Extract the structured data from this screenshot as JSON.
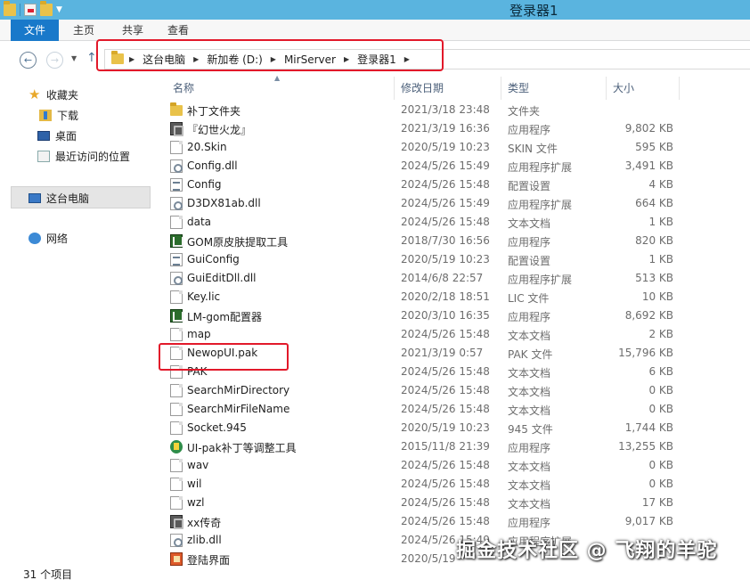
{
  "window": {
    "title": "登录器1"
  },
  "ribbon": {
    "tabs": [
      {
        "label": "文件"
      },
      {
        "label": "主页"
      },
      {
        "label": "共享"
      },
      {
        "label": "查看"
      }
    ]
  },
  "address": {
    "crumbs": [
      "这台电脑",
      "新加卷 (D:)",
      "MirServer",
      "登录器1"
    ]
  },
  "nav": {
    "favorites_label": "收藏夹",
    "downloads_label": "下载",
    "desktop_label": "桌面",
    "recent_label": "最近访问的位置",
    "this_pc_label": "这台电脑",
    "network_label": "网络"
  },
  "columns": {
    "name": "名称",
    "date": "修改日期",
    "type": "类型",
    "size": "大小"
  },
  "files": [
    {
      "name": "补丁文件夹",
      "date": "2021/3/18 23:48",
      "type": "文件夹",
      "size": "",
      "icon": "folder-icon"
    },
    {
      "name": "『幻世火龙』",
      "date": "2021/3/19 16:36",
      "type": "应用程序",
      "size": "9,802 KB",
      "icon": "dragon-app-icon"
    },
    {
      "name": "20.Skin",
      "date": "2020/5/19 10:23",
      "type": "SKIN 文件",
      "size": "595 KB",
      "icon": "file-icon"
    },
    {
      "name": "Config.dll",
      "date": "2024/5/26 15:49",
      "type": "应用程序扩展",
      "size": "3,491 KB",
      "icon": "dll-icon"
    },
    {
      "name": "Config",
      "date": "2024/5/26 15:48",
      "type": "配置设置",
      "size": "4 KB",
      "icon": "config-icon"
    },
    {
      "name": "D3DX81ab.dll",
      "date": "2024/5/26 15:49",
      "type": "应用程序扩展",
      "size": "664 KB",
      "icon": "dll-icon"
    },
    {
      "name": "data",
      "date": "2024/5/26 15:48",
      "type": "文本文档",
      "size": "1 KB",
      "icon": "file-icon"
    },
    {
      "name": "GOM原皮肤提取工具",
      "date": "2018/7/30 16:56",
      "type": "应用程序",
      "size": "820 KB",
      "icon": "gom-app-icon"
    },
    {
      "name": "GuiConfig",
      "date": "2020/5/19 10:23",
      "type": "配置设置",
      "size": "1 KB",
      "icon": "config-icon"
    },
    {
      "name": "GuiEditDll.dll",
      "date": "2014/6/8 22:57",
      "type": "应用程序扩展",
      "size": "513 KB",
      "icon": "dll-icon"
    },
    {
      "name": "Key.lic",
      "date": "2020/2/18 18:51",
      "type": "LIC 文件",
      "size": "10 KB",
      "icon": "file-icon"
    },
    {
      "name": "LM-gom配置器",
      "date": "2020/3/10 16:35",
      "type": "应用程序",
      "size": "8,692 KB",
      "icon": "gom-app-icon"
    },
    {
      "name": "map",
      "date": "2024/5/26 15:48",
      "type": "文本文档",
      "size": "2 KB",
      "icon": "file-icon"
    },
    {
      "name": "NewopUI.pak",
      "date": "2021/3/19 0:57",
      "type": "PAK 文件",
      "size": "15,796 KB",
      "icon": "file-icon"
    },
    {
      "name": "PAK",
      "date": "2024/5/26 15:48",
      "type": "文本文档",
      "size": "6 KB",
      "icon": "file-icon"
    },
    {
      "name": "SearchMirDirectory",
      "date": "2024/5/26 15:48",
      "type": "文本文档",
      "size": "0 KB",
      "icon": "file-icon"
    },
    {
      "name": "SearchMirFileName",
      "date": "2024/5/26 15:48",
      "type": "文本文档",
      "size": "0 KB",
      "icon": "file-icon"
    },
    {
      "name": "Socket.945",
      "date": "2020/5/19 10:23",
      "type": "945 文件",
      "size": "1,744 KB",
      "icon": "file-icon"
    },
    {
      "name": "UI-pak补丁等调整工具",
      "date": "2015/11/8 21:39",
      "type": "应用程序",
      "size": "13,255 KB",
      "icon": "ui-app-icon"
    },
    {
      "name": "wav",
      "date": "2024/5/26 15:48",
      "type": "文本文档",
      "size": "0 KB",
      "icon": "file-icon"
    },
    {
      "name": "wil",
      "date": "2024/5/26 15:48",
      "type": "文本文档",
      "size": "0 KB",
      "icon": "file-icon"
    },
    {
      "name": "wzl",
      "date": "2024/5/26 15:48",
      "type": "文本文档",
      "size": "17 KB",
      "icon": "file-icon"
    },
    {
      "name": "xx传奇",
      "date": "2024/5/26 15:48",
      "type": "应用程序",
      "size": "9,017 KB",
      "icon": "dragon-app-icon"
    },
    {
      "name": "zlib.dll",
      "date": "2024/5/26 15:49",
      "type": "应用程序扩展",
      "size": "",
      "icon": "dll-icon"
    },
    {
      "name": "登陆界面",
      "date": "2020/5/19",
      "type": "",
      "size": "",
      "icon": "login-app-icon"
    }
  ],
  "status": {
    "item_count": "31 个项目"
  },
  "watermark": {
    "text": "掘金技术社区 @ 飞翔的羊驼"
  }
}
